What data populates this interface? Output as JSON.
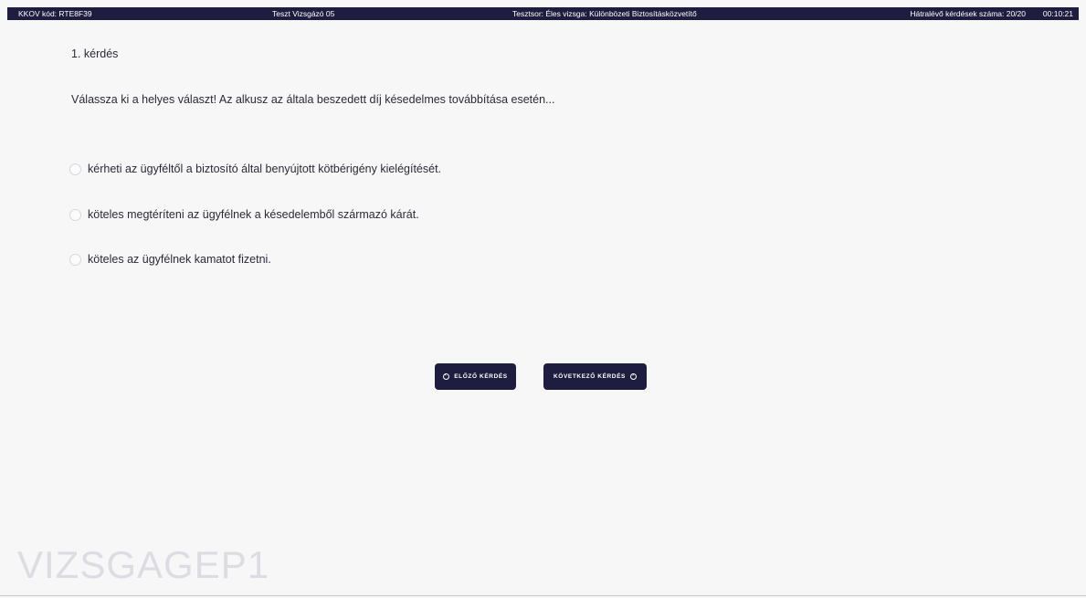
{
  "header": {
    "kkov_code": "KKOV kód: RTE8F39",
    "candidate": "Teszt Vizsgázó 05",
    "test_set": "Tesztsor: Éles vizsga: Különbözeti Biztosításközvetítő",
    "remaining": "Hátralévő kérdések száma: 20/20",
    "timer": "00:10:21"
  },
  "question": {
    "number": "1. kérdés",
    "text": "Válassza ki a helyes választ! Az alkusz az általa beszedett díj késedelmes továbbítása esetén...",
    "answers": [
      {
        "label": "kérheti az ügyféltől a biztosító által benyújtott kötbérigény kielégítését."
      },
      {
        "label": "köteles megtéríteni az ügyfélnek a késedelemből származó kárát."
      },
      {
        "label": "köteles az ügyfélnek kamatot fizetni."
      }
    ]
  },
  "nav": {
    "prev_label": "ELŐZŐ KÉRDÉS",
    "next_label": "KÖVETKEZŐ KÉRDÉS"
  },
  "watermark": "VIZSGAGEP1",
  "colors": {
    "header_bg": "#1f1d3f",
    "button_bg": "#1f1d3f",
    "page_bg": "#f7f7f8"
  }
}
